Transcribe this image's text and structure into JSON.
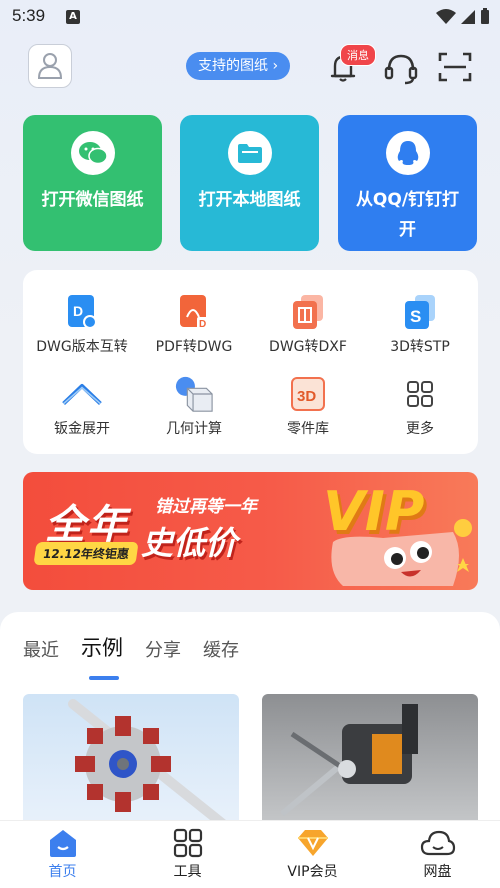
{
  "status": {
    "time": "5:39",
    "notif_letter": "A"
  },
  "header": {
    "supported_label": "支持的图纸 ›",
    "msg_badge": "消息"
  },
  "big_cards": [
    {
      "label": "打开微信图纸"
    },
    {
      "label": "打开本地图纸"
    },
    {
      "label": "从QQ/钉钉打开"
    }
  ],
  "tools": [
    {
      "label": "DWG版本互转",
      "icon": "dwg-convert-icon"
    },
    {
      "label": "PDF转DWG",
      "icon": "pdf-icon"
    },
    {
      "label": "DWG转DXF",
      "icon": "dxf-icon"
    },
    {
      "label": "3D转STP",
      "icon": "stp-icon"
    },
    {
      "label": "钣金展开",
      "icon": "sheet-metal-icon"
    },
    {
      "label": "几何计算",
      "icon": "geometry-icon"
    },
    {
      "label": "零件库",
      "icon": "parts-3d-icon"
    },
    {
      "label": "更多",
      "icon": "grid-icon"
    }
  ],
  "banner": {
    "big": "全年",
    "sub": "错过再等一年",
    "low": "史低价",
    "tag": "12.12年终钜惠",
    "vip": "VIP"
  },
  "tabs": [
    {
      "label": "最近",
      "active": false
    },
    {
      "label": "示例",
      "active": true
    },
    {
      "label": "分享",
      "active": false
    },
    {
      "label": "缓存",
      "active": false
    }
  ],
  "nav": [
    {
      "label": "首页",
      "active": true
    },
    {
      "label": "工具",
      "active": false
    },
    {
      "label": "VIP会员",
      "active": false
    },
    {
      "label": "网盘",
      "active": false
    }
  ],
  "colors": {
    "accent": "#3c7fee",
    "wechat": "#33c071",
    "local": "#27b9d6",
    "qq": "#2f7ef0",
    "banner": "#f34d3c"
  }
}
